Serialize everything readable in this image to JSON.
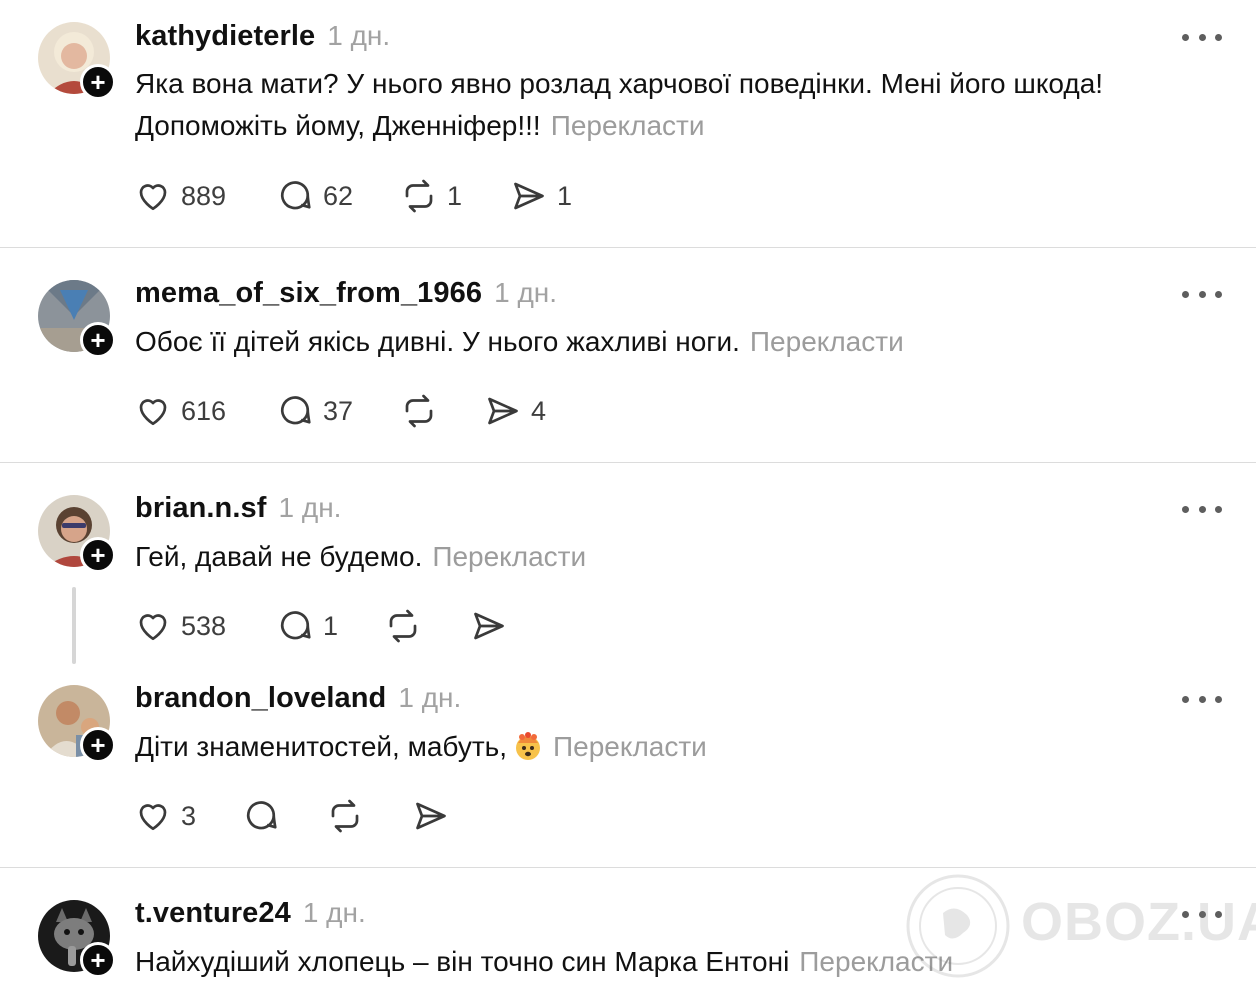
{
  "translate_label": "Перекласти",
  "posts": [
    {
      "username": "kathydieterle",
      "time": "1 дн.",
      "text": "Яка вона мати? У нього явно розлад харчової поведінки. Мені його шкода! Допоможіть йому, Дженніфер!!!",
      "likes": "889",
      "replies": "62",
      "reposts": "1",
      "shares": "1"
    },
    {
      "username": "mema_of_six_from_1966",
      "time": "1 дн.",
      "text": "Обоє її дітей якісь дивні. У нього жахливі ноги.",
      "likes": "616",
      "replies": "37",
      "reposts": "",
      "shares": "4"
    },
    {
      "username": "brian.n.sf",
      "time": "1 дн.",
      "text": "Гей, давай не будемо.",
      "likes": "538",
      "replies": "1",
      "reposts": "",
      "shares": ""
    },
    {
      "username": "brandon_loveland",
      "time": "1 дн.",
      "text": "Діти знаменитостей, мабуть,",
      "emoji": "exploding-head-emoji",
      "likes": "3",
      "replies": "",
      "reposts": "",
      "shares": ""
    },
    {
      "username": "t.venture24",
      "time": "1 дн.",
      "text": "Найхудіший хлопець – він точно син Марка Ентоні",
      "likes": "",
      "replies": "",
      "reposts": "",
      "shares": ""
    }
  ],
  "watermark": "OBOZ.UA",
  "icons": {
    "like": "heart-icon",
    "reply": "comment-bubble-icon",
    "repost": "repost-arrows-icon",
    "share": "send-icon",
    "more": "more-dots-icon",
    "follow": "plus-icon"
  },
  "colors": {
    "text": "#111111",
    "muted": "#9c9c9c",
    "divider": "#dcdcdc",
    "badge": "#0a0a0a"
  }
}
